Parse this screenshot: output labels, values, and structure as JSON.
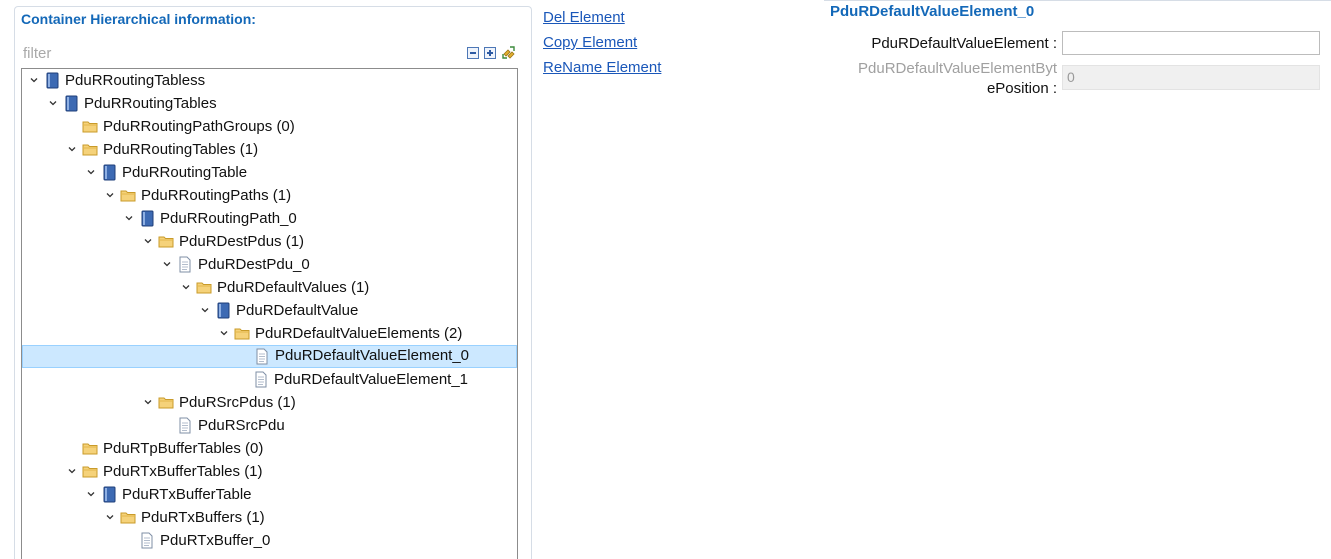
{
  "left_panel": {
    "title": "Container Hierarchical information:",
    "filter_placeholder": "filter"
  },
  "tree": [
    {
      "label": "PduRRoutingTabless",
      "level": 0,
      "expanded": true,
      "icon": "module-icon"
    },
    {
      "label": "PduRRoutingTables",
      "level": 1,
      "expanded": true,
      "icon": "module-icon"
    },
    {
      "label": "PduRRoutingPathGroups (0)",
      "level": 2,
      "expanded": null,
      "icon": "folder-icon"
    },
    {
      "label": "PduRRoutingTables (1)",
      "level": 2,
      "expanded": true,
      "icon": "folder-icon"
    },
    {
      "label": "PduRRoutingTable",
      "level": 3,
      "expanded": true,
      "icon": "module-icon"
    },
    {
      "label": "PduRRoutingPaths (1)",
      "level": 4,
      "expanded": true,
      "icon": "folder-icon"
    },
    {
      "label": "PduRRoutingPath_0",
      "level": 5,
      "expanded": true,
      "icon": "module-icon"
    },
    {
      "label": "PduRDestPdus (1)",
      "level": 6,
      "expanded": true,
      "icon": "folder-icon"
    },
    {
      "label": "PduRDestPdu_0",
      "level": 7,
      "expanded": true,
      "icon": "document-icon"
    },
    {
      "label": "PduRDefaultValues (1)",
      "level": 8,
      "expanded": true,
      "icon": "folder-icon"
    },
    {
      "label": "PduRDefaultValue",
      "level": 9,
      "expanded": true,
      "icon": "module-icon"
    },
    {
      "label": "PduRDefaultValueElements (2)",
      "level": 10,
      "expanded": true,
      "icon": "folder-icon"
    },
    {
      "label": "PduRDefaultValueElement_0",
      "level": 11,
      "expanded": null,
      "icon": "document-icon",
      "selected": true
    },
    {
      "label": "PduRDefaultValueElement_1",
      "level": 11,
      "expanded": null,
      "icon": "document-icon"
    },
    {
      "label": "PduRSrcPdus (1)",
      "level": 6,
      "expanded": true,
      "icon": "folder-icon"
    },
    {
      "label": "PduRSrcPdu",
      "level": 7,
      "expanded": null,
      "icon": "document-icon"
    },
    {
      "label": "PduRTpBufferTables (0)",
      "level": 2,
      "expanded": null,
      "icon": "folder-icon"
    },
    {
      "label": "PduRTxBufferTables (1)",
      "level": 2,
      "expanded": true,
      "icon": "folder-icon"
    },
    {
      "label": "PduRTxBufferTable",
      "level": 3,
      "expanded": true,
      "icon": "module-icon"
    },
    {
      "label": "PduRTxBuffers (1)",
      "level": 4,
      "expanded": true,
      "icon": "folder-icon"
    },
    {
      "label": "PduRTxBuffer_0",
      "level": 5,
      "expanded": null,
      "icon": "document-icon"
    }
  ],
  "actions": {
    "del": "Del Element",
    "copy": "Copy Element",
    "rename": "ReName Element"
  },
  "properties": {
    "title": "PduRDefaultValueElement_0",
    "element_label": "PduRDefaultValueElement :",
    "element_value": "",
    "byte_position_label_line1": "PduRDefaultValueElementByt",
    "byte_position_label_line2": "ePosition :",
    "byte_position_value": "0"
  },
  "colors": {
    "title_blue": "#1368b8",
    "link_blue": "#1a57b9",
    "selection": "#cce8ff"
  }
}
